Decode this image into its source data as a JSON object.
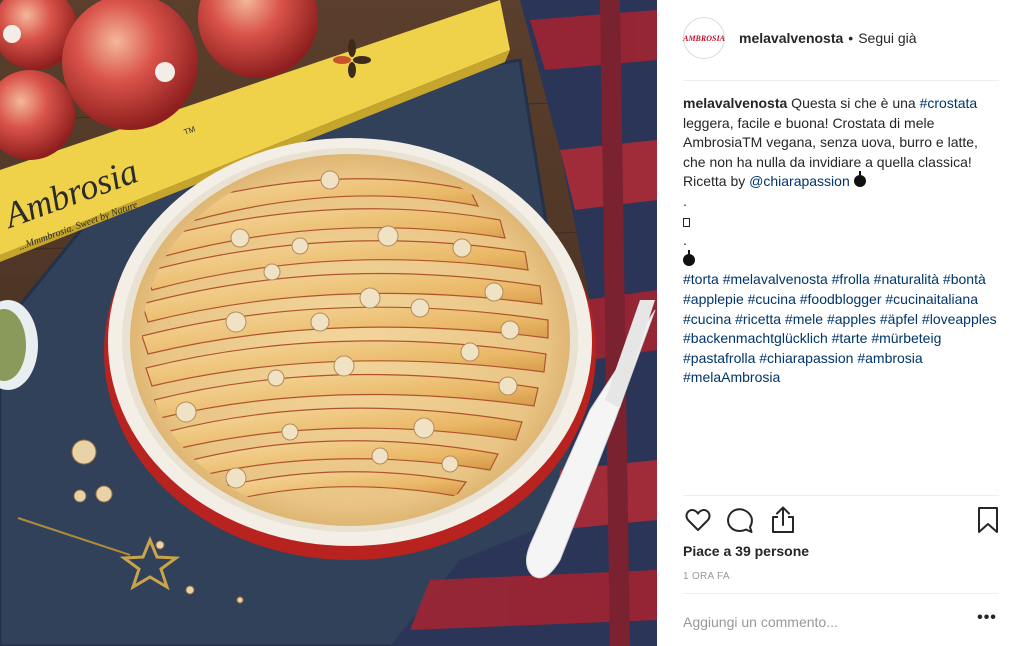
{
  "photo": {
    "alt": "",
    "box_brand": "Ambrosia",
    "box_trademark": "TM",
    "box_slogan": "...Mmmbrosia. Sweet by Nature"
  },
  "header": {
    "avatar_text": "AMBROSIA",
    "username": "melavalvenosta",
    "separator": "•",
    "follow_label": "Segui già"
  },
  "caption": {
    "username": "melavalvenosta",
    "text_1": " Questa si che è una ",
    "tag_crostata": "#crostata",
    "text_2": " leggera, facile e buona! Crostata di mele AmbrosiaTM vegana, senza uova, burro e latte, che non ha nulla da invidiare a quella classica! Ricetta by ",
    "mention": "@chiarapassion",
    "dot_1": ".",
    "dot_2": ".",
    "hashtags": "#torta #melavalvenosta #frolla #naturalità #bontà #applepie #cucina #foodblogger #cucinaitaliana #cucina #ricetta #mele #apples #äpfel #loveapples #backenmachtglücklich #tarte #mürbeteig #pastafrolla #chiarapassion #ambrosia #melaAmbrosia"
  },
  "actions": {
    "like_icon": "heart-icon",
    "comment_icon": "comment-icon",
    "share_icon": "share-icon",
    "save_icon": "bookmark-icon"
  },
  "likes_text": "Piace a 39 persone",
  "timestamp": "1 ORA FA",
  "comment": {
    "placeholder": "Aggiungi un commento...",
    "more_label": "•••"
  },
  "colors": {
    "link": "#003569",
    "muted": "#999999",
    "divider": "#efefef"
  }
}
